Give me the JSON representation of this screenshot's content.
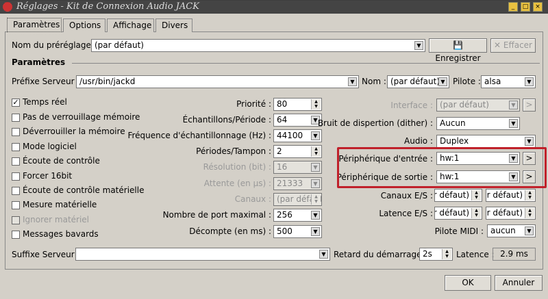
{
  "window": {
    "title": "Réglages - Kit de Connexion Audio JACK",
    "buttons": [
      "_",
      "□",
      "×"
    ]
  },
  "tabs": [
    "Paramètres",
    "Options",
    "Affichage",
    "Divers"
  ],
  "preset": {
    "label": "Nom du préréglage :",
    "value": "(par défaut)",
    "save": "Enregistrer",
    "delete": "Effacer"
  },
  "group_title": "Paramètres",
  "server": {
    "prefix_label": "Préfixe Serveur :",
    "prefix_value": "/usr/bin/jackd",
    "name_label": "Nom :",
    "name_value": "(par défaut)",
    "driver_label": "Pilote :",
    "driver_value": "alsa"
  },
  "checkboxes": [
    {
      "label": "Temps réel",
      "checked": true,
      "enabled": true
    },
    {
      "label": "Pas de verrouillage mémoire",
      "checked": false,
      "enabled": true
    },
    {
      "label": "Déverrouiller la mémoire",
      "checked": false,
      "enabled": true
    },
    {
      "label": "Mode logiciel",
      "checked": false,
      "enabled": true
    },
    {
      "label": "Écoute de contrôle",
      "checked": false,
      "enabled": true
    },
    {
      "label": "Forcer 16bit",
      "checked": false,
      "enabled": true
    },
    {
      "label": "Écoute de contrôle matérielle",
      "checked": false,
      "enabled": true
    },
    {
      "label": "Mesure matérielle",
      "checked": false,
      "enabled": true
    },
    {
      "label": "Ignorer matériel",
      "checked": false,
      "enabled": false
    },
    {
      "label": "Messages bavards",
      "checked": false,
      "enabled": true
    }
  ],
  "middle": [
    {
      "label": "Priorité :",
      "value": "80",
      "kind": "spin",
      "enabled": true
    },
    {
      "label": "Échantillons/Période :",
      "value": "64",
      "kind": "combo",
      "enabled": true
    },
    {
      "label": "Fréquence d'échantillonnage (Hz) :",
      "value": "44100",
      "kind": "combo",
      "enabled": true
    },
    {
      "label": "Périodes/Tampon :",
      "value": "2",
      "kind": "spin",
      "enabled": true
    },
    {
      "label": "Résolution (bit) :",
      "value": "16",
      "kind": "combo",
      "enabled": false
    },
    {
      "label": "Attente (en µs) :",
      "value": "21333",
      "kind": "combo",
      "enabled": false
    },
    {
      "label": "Canaux :",
      "value": "(par défaut)",
      "kind": "spin",
      "enabled": false
    },
    {
      "label": "Nombre de port maximal :",
      "value": "256",
      "kind": "combo",
      "enabled": true
    },
    {
      "label": "Décompte (en ms) :",
      "value": "500",
      "kind": "combo",
      "enabled": true
    }
  ],
  "right": {
    "interface": {
      "label": "Interface :",
      "value": "(par défaut)"
    },
    "dither": {
      "label": "Bruit de dispertion (dither) :",
      "value": "Aucun"
    },
    "audio": {
      "label": "Audio :",
      "value": "Duplex"
    },
    "input_device": {
      "label": "Périphérique d'entrée :",
      "value": "hw:1"
    },
    "output_device": {
      "label": "Périphérique de sortie :",
      "value": "hw:1"
    },
    "channels": {
      "label": "Canaux E/S :",
      "in": "(par défaut)",
      "out": "(par défaut)"
    },
    "latency": {
      "label": "Latence E/S :",
      "in": "(par défaut)",
      "out": "(par défaut)"
    },
    "midi": {
      "label": "Pilote MIDI :",
      "value": "aucun"
    },
    "more": ">"
  },
  "highlight_color": "#c0202a",
  "bottom": {
    "suffix_label": "Suffixe Serveur :",
    "suffix_value": "",
    "delay_label": "Retard du démarrage :",
    "delay_value": "2s",
    "latency_label": "Latence :",
    "latency_value": "2.9 ms"
  },
  "dialog": {
    "ok": "OK",
    "cancel": "Annuler"
  }
}
